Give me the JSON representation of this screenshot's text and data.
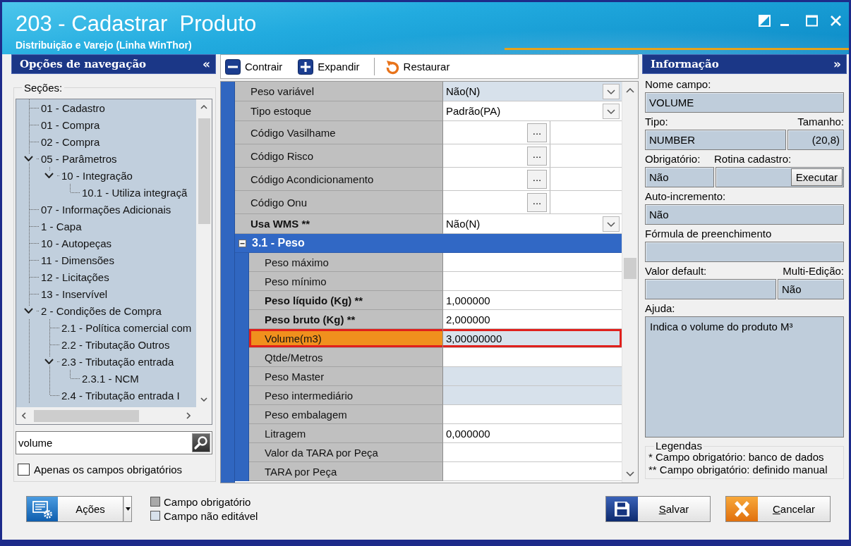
{
  "window": {
    "title": "203 - Cadastrar  Produto",
    "subtitle": "Distribuição e Varejo (Linha WinThor)"
  },
  "nav": {
    "title": "Opções de navegação",
    "toggle": "«",
    "sections_label": "Seções:",
    "tree": [
      {
        "label": "01 - Cadastro"
      },
      {
        "label": "01 - Compra"
      },
      {
        "label": "02 - Compra"
      },
      {
        "label": "05 - Parâmetros",
        "expanded": true,
        "children": [
          {
            "label": "10 - Integração",
            "expanded": true,
            "children": [
              {
                "label": "10.1 - Utiliza integraçã"
              }
            ]
          }
        ]
      },
      {
        "label": "07 - Informações Adicionais"
      },
      {
        "label": "1 - Capa"
      },
      {
        "label": "10 - Autopeças"
      },
      {
        "label": "11 - Dimensões"
      },
      {
        "label": "12 - Licitações"
      },
      {
        "label": "13 - Inservível"
      },
      {
        "label": "2 - Condições de Compra",
        "expanded": true,
        "children": [
          {
            "label": "2.1 - Política comercial com"
          },
          {
            "label": "2.2 - Tributação Outros"
          },
          {
            "label": "2.3 - Tributação entrada",
            "expanded": true,
            "children": [
              {
                "label": "2.3.1 - NCM"
              }
            ]
          },
          {
            "label": "2.4 - Tributação entrada I"
          }
        ]
      }
    ],
    "search": {
      "value": "volume"
    },
    "required_only": {
      "label": "Apenas os campos obrigatórios",
      "checked": false
    }
  },
  "toolbar": [
    {
      "label": "Contrair",
      "kind": "collapse"
    },
    {
      "label": "Expandir",
      "kind": "expand"
    },
    {
      "label": "Restaurar",
      "kind": "restore"
    }
  ],
  "grid": {
    "rows": [
      {
        "label": "Peso variável",
        "kind": "dropdown",
        "value": "Não(N)",
        "required": false,
        "editable": false,
        "selected": false
      },
      {
        "label": "Tipo estoque",
        "kind": "dropdown",
        "value": "Padrão(PA)",
        "required": false,
        "editable": true,
        "selected": false
      },
      {
        "label": "Código Vasilhame",
        "kind": "lookup",
        "button": "...",
        "required": false,
        "editable": true,
        "selected": false
      },
      {
        "label": "Código Risco",
        "kind": "lookup",
        "button": "...",
        "required": false,
        "editable": true,
        "selected": false
      },
      {
        "label": "Código Acondicionamento",
        "kind": "lookup",
        "button": "...",
        "required": false,
        "editable": true,
        "selected": false
      },
      {
        "label": "Código Onu",
        "kind": "lookup",
        "button": "...",
        "required": false,
        "editable": true,
        "selected": false
      },
      {
        "label": "Usa WMS **",
        "kind": "dropdown",
        "value": "Não(N)",
        "required": true,
        "editable": true,
        "selected": false
      },
      {
        "label": "3.1 - Peso",
        "kind": "category",
        "expanded": true,
        "children": [
          {
            "label": "Peso máximo",
            "kind": "text",
            "required": false,
            "editable": true,
            "selected": false
          },
          {
            "label": "Peso mínimo",
            "kind": "text",
            "required": false,
            "editable": true,
            "selected": false
          },
          {
            "label": "Peso líquido (Kg) **",
            "kind": "text",
            "value": "1,000000",
            "required": true,
            "editable": true,
            "selected": false
          },
          {
            "label": "Peso bruto (Kg) **",
            "kind": "text",
            "value": "2,000000",
            "required": true,
            "editable": true,
            "selected": false
          },
          {
            "label": "Volume(m3)",
            "kind": "text",
            "value": "3,00000000",
            "required": false,
            "editable": true,
            "selected": true
          },
          {
            "label": "Qtde/Metros",
            "kind": "text",
            "required": false,
            "editable": true,
            "selected": false
          },
          {
            "label": "Peso Master",
            "kind": "text",
            "required": false,
            "editable": false,
            "selected": false
          },
          {
            "label": "Peso intermediário",
            "kind": "text",
            "required": false,
            "editable": false,
            "selected": false
          },
          {
            "label": "Peso embalagem",
            "kind": "text",
            "required": false,
            "editable": true,
            "selected": false
          },
          {
            "label": "Litragem",
            "kind": "text",
            "value": "0,000000",
            "required": false,
            "editable": true,
            "selected": false
          },
          {
            "label": "Valor da TARA por Peça",
            "kind": "text",
            "required": false,
            "editable": true,
            "selected": false
          },
          {
            "label": "TARA por Peça",
            "kind": "text",
            "required": false,
            "editable": true,
            "selected": false
          }
        ]
      }
    ]
  },
  "info": {
    "title": "Informação",
    "toggle": "»",
    "field_name": {
      "label": "Nome campo:",
      "value": "VOLUME"
    },
    "type": {
      "label": "Tipo:",
      "value": "NUMBER"
    },
    "size": {
      "label": "Tamanho:",
      "value": "(20,8)"
    },
    "mandatory": {
      "label": "Obrigatório:",
      "value": "Não"
    },
    "routine": {
      "label": "Rotina cadastro:",
      "button": "Executar"
    },
    "auto_increment": {
      "label": "Auto-incremento:",
      "value": "Não"
    },
    "formula": {
      "label": "Fórmula de preenchimento"
    },
    "default_value": {
      "label": "Valor default:"
    },
    "multi_edit": {
      "label": "Multi-Edição:",
      "value": "Não"
    },
    "help": {
      "label": "Ajuda:",
      "value": "Indica o volume do produto M³"
    },
    "legend": {
      "title": "Legendas",
      "lines": [
        "* Campo obrigatório: banco de dados",
        "** Campo obrigatório: definido manual"
      ]
    }
  },
  "footer": {
    "actions": {
      "label": "Ações"
    },
    "legend": [
      {
        "label": "Campo obrigatório",
        "color": "#a9a9a9"
      },
      {
        "label": "Campo não editável",
        "color": "#d7e1eb"
      }
    ],
    "buttons": [
      {
        "label": "Salvar",
        "kind": "save"
      },
      {
        "label": "Cancelar",
        "kind": "cancel"
      }
    ]
  }
}
